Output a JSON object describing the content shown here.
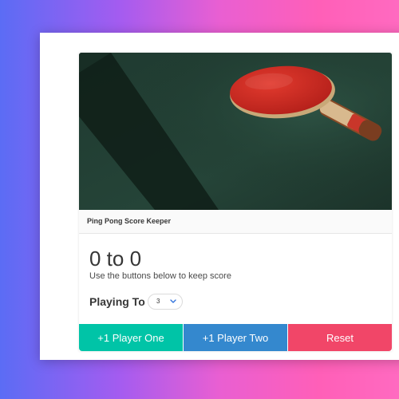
{
  "card": {
    "title": "Ping Pong Score Keeper",
    "image_alt": "ping-pong-paddle-photo"
  },
  "score": {
    "player_one": 0,
    "player_two": 0,
    "display": "0 to 0"
  },
  "hint": "Use the buttons below to keep score",
  "playing_to": {
    "label": "Playing To",
    "selected": "3"
  },
  "buttons": {
    "player_one": "+1 Player One",
    "player_two": "+1 Player Two",
    "reset": "Reset"
  },
  "colors": {
    "player_one": "#00c4a7",
    "player_two": "#3488ce",
    "reset": "#f14668"
  }
}
